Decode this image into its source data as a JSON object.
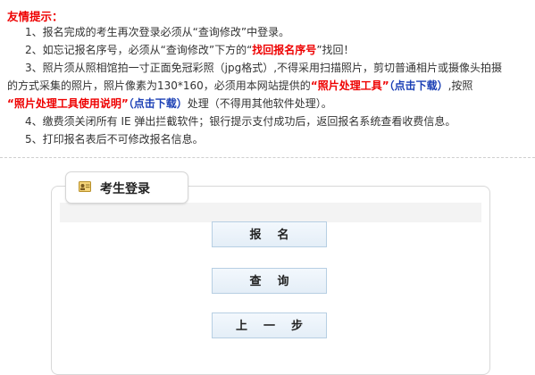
{
  "tips": {
    "title": "友情提示：",
    "item1": "1、报名完成的考生再次登录必须从“查询修改”中登录。",
    "item2_a": "2、如忘记报名序号，必须从“查询修改”下方的“",
    "item2_b": "找回报名序号",
    "item2_c": "”找回！",
    "item3_l1": "3、照片须从照相馆拍一寸正面免冠彩照（jpg格式）,不得采用扫描照片，剪切普通相片或摄像头拍摄",
    "item3_l2_a": "的方式采集的照片，照片像素为130*160，必须用本网站提供的",
    "item3_l2_b": "“照片处理工具”",
    "item3_l2_c": "（点击下载）",
    "item3_l2_d": ",按照",
    "item3_l3_a": "“照片处理工具使用说明”",
    "item3_l3_b": "（点击下载）",
    "item3_l3_c": "处理（不得用其他软件处理）。",
    "item4": "4、缴费须关闭所有  IE 弹出拦截软件；银行提示支付成功后，返回报名系统查看收费信息。",
    "item5": "5、打印报名表后不可修改报名信息。"
  },
  "login": {
    "title": "考生登录",
    "icon": "id-card-icon"
  },
  "buttons": {
    "register": "报名",
    "query": "查询",
    "previous": "上一步"
  },
  "colors": {
    "accent_red": "#e00000",
    "link_blue": "#1a3fb5"
  }
}
